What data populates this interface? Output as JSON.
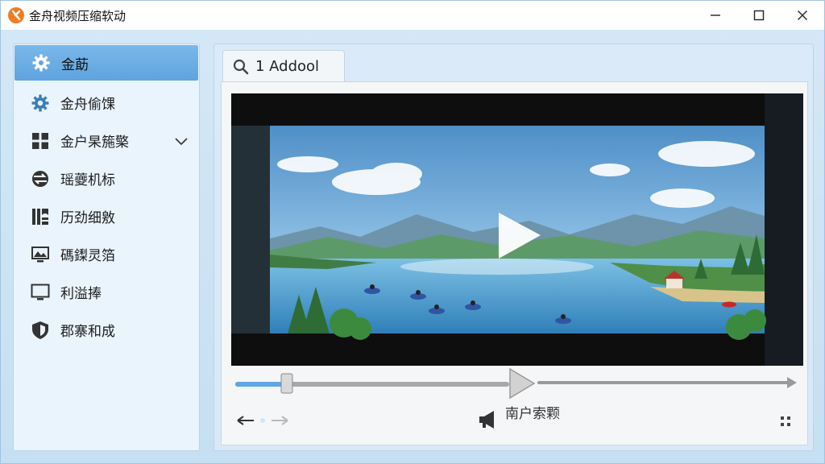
{
  "window": {
    "title": "金舟视频压缩软动"
  },
  "sidebar": {
    "items": [
      {
        "label": "金莇",
        "icon": "gear-icon",
        "active": true
      },
      {
        "label": "金舟偷馃",
        "icon": "settings-gear-icon",
        "active": false
      },
      {
        "label": "金户杲箷檠",
        "icon": "grid-icon",
        "active": false,
        "expandable": true
      },
      {
        "label": "瑶䕫机标",
        "icon": "transfer-icon",
        "active": false
      },
      {
        "label": "历劲细敫",
        "icon": "layout-icon",
        "active": false
      },
      {
        "label": "碼鏫灵箔",
        "icon": "image-monitor-icon",
        "active": false
      },
      {
        "label": "利溢捧",
        "icon": "monitor-icon",
        "active": false
      },
      {
        "label": "郡寨和成",
        "icon": "shield-icon",
        "active": false
      }
    ]
  },
  "tab": {
    "label": "1 Addool",
    "icon": "search-icon"
  },
  "player": {
    "progress": 0.1,
    "bottom_label": "南户索颗"
  },
  "colors": {
    "accent": "#5ea3df",
    "sidebar_bg": "#ebf5fd",
    "titlebar_bg": "#ffffff"
  }
}
